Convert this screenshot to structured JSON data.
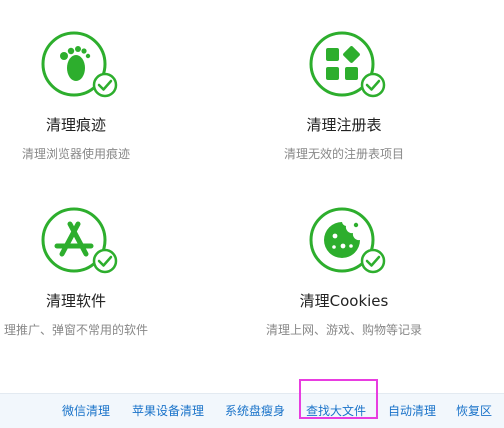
{
  "colors": {
    "accent_green": "#2dae2d",
    "link_blue": "#1a73c9",
    "highlight": "#e83de0"
  },
  "tiles": [
    {
      "title": "清理痕迹",
      "subtitle": "清理浏览器使用痕迹",
      "icon": "footprint-icon"
    },
    {
      "title": "清理注册表",
      "subtitle": "清理无效的注册表项目",
      "icon": "registry-icon"
    },
    {
      "title": "清理软件",
      "subtitle": "理推广、弹窗不常用的软件",
      "icon": "app-store-icon"
    },
    {
      "title": "清理Cookies",
      "subtitle": "清理上网、游戏、购物等记录",
      "icon": "cookie-icon"
    }
  ],
  "bottom_bar": {
    "links": [
      "微信清理",
      "苹果设备清理",
      "系统盘瘦身",
      "查找大文件",
      "自动清理",
      "恢复区"
    ]
  }
}
